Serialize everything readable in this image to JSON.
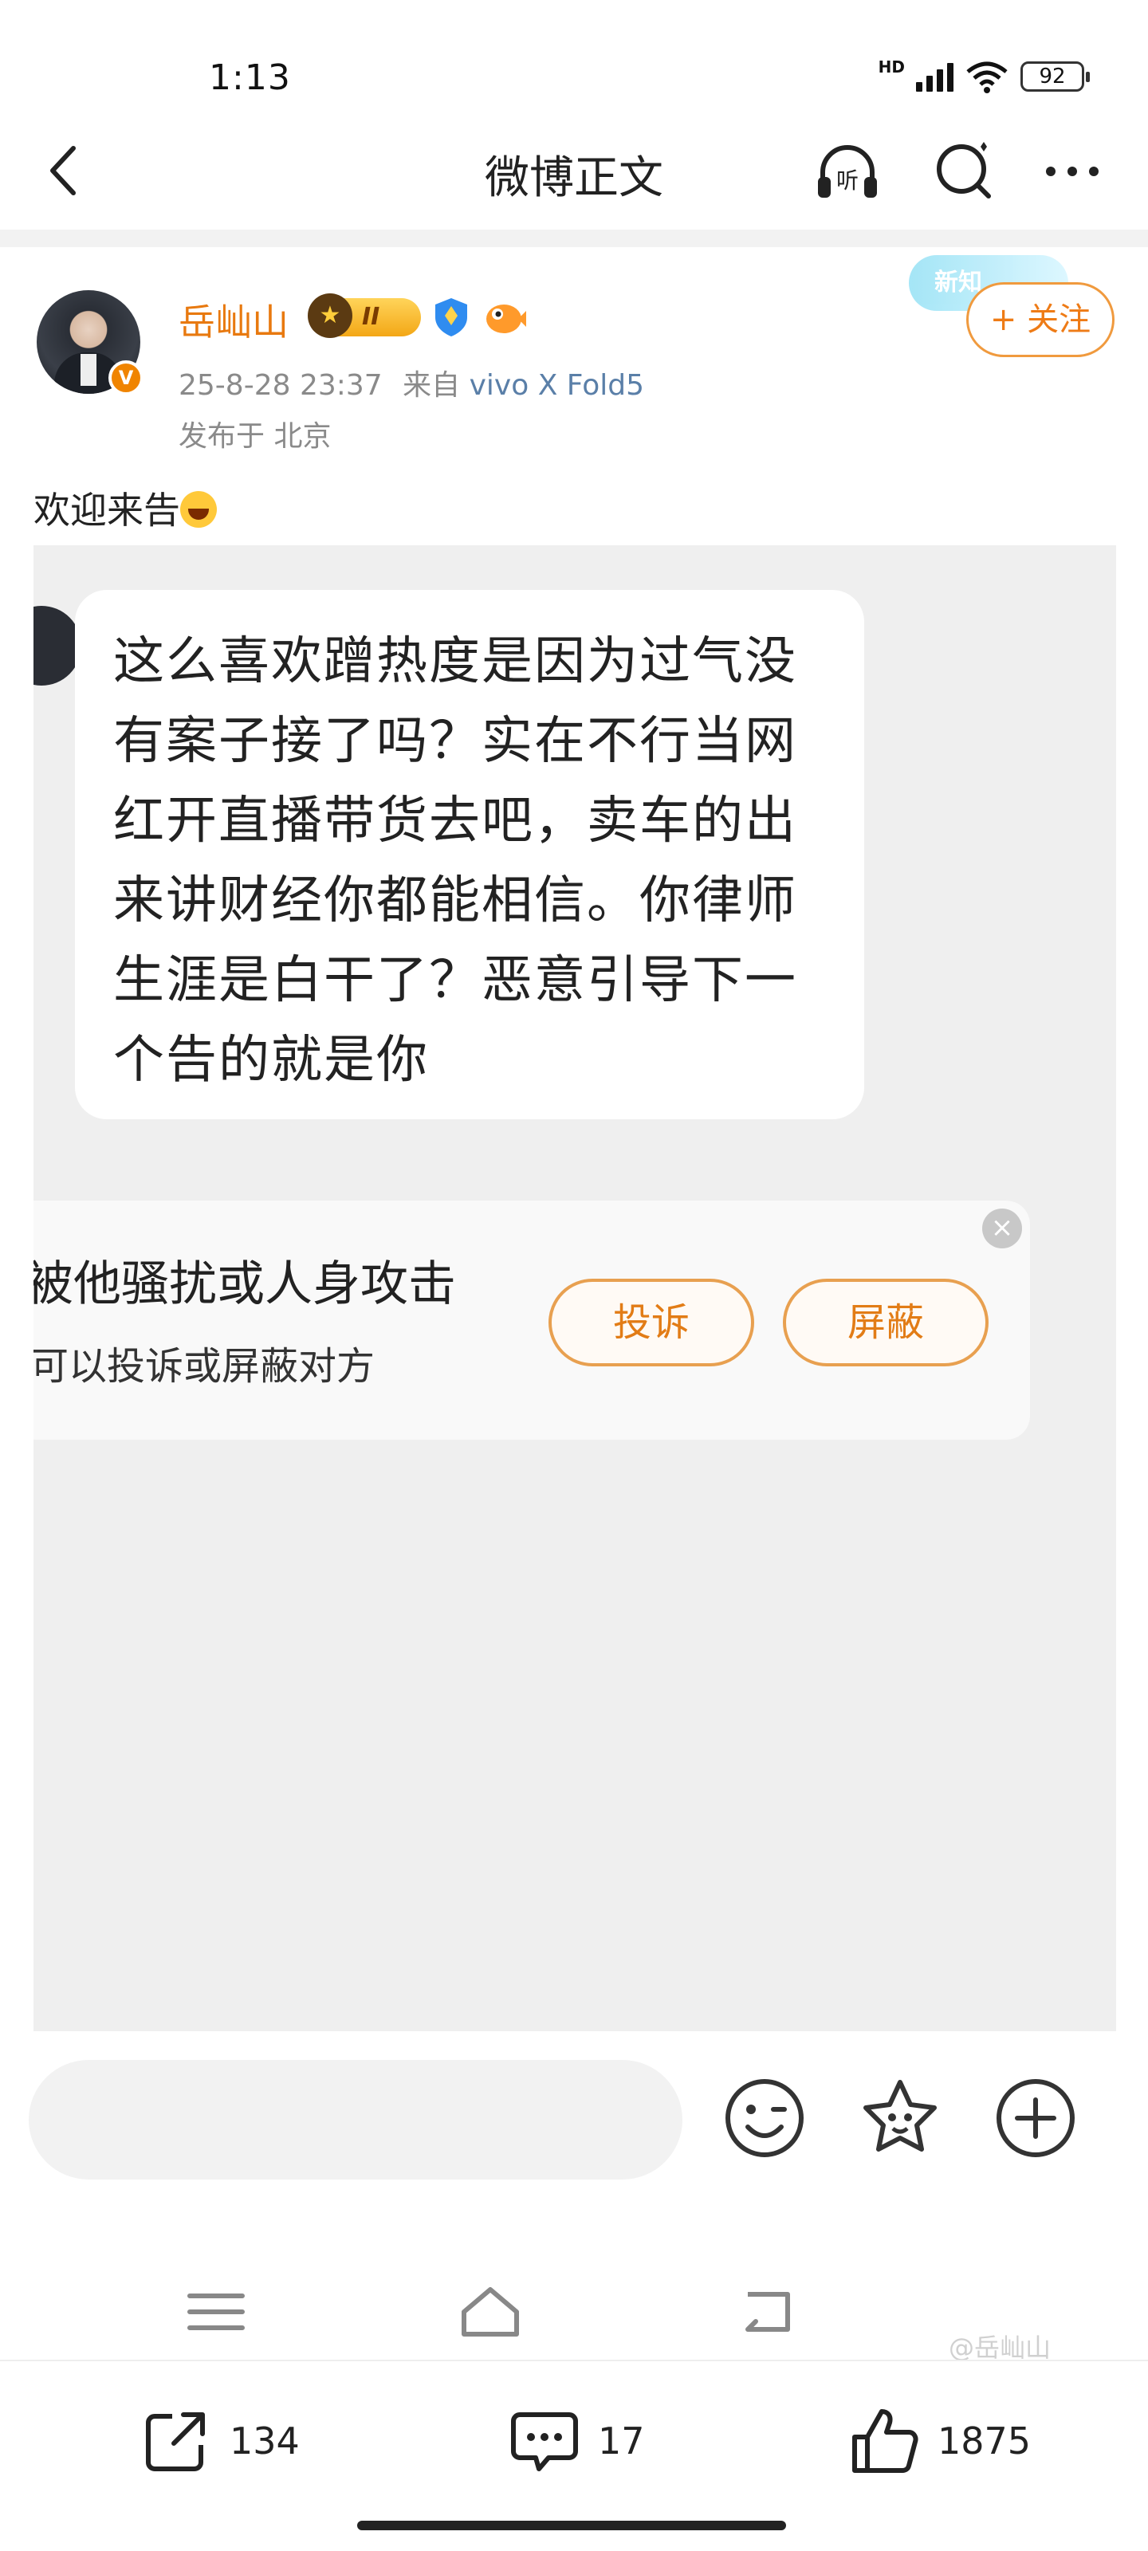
{
  "status_bar": {
    "time": "1:13",
    "network": "HD",
    "battery": "92"
  },
  "nav": {
    "title": "微博正文",
    "listen_label": "听"
  },
  "post": {
    "author": "岳屾山",
    "level_badge": "II",
    "avatar_badge": "V",
    "timestamp": "25-8-28 23:37",
    "source_prefix": "来自",
    "device": "vivo X Fold5",
    "location": "发布于 北京",
    "new_chip": "新知",
    "follow_label": "+ 关注",
    "text": "欢迎来告"
  },
  "screenshot": {
    "message_lines": [
      "这么喜欢蹭热度是因为过气没",
      "有案子接了吗？实在不行当网",
      "红开直播带货去吧，卖车的出",
      "来讲财经你都能相信。你律师",
      "生涯是白干了？恶意引导下一",
      "个告的就是你"
    ],
    "tip_title": "被他骚扰或人身攻击",
    "tip_subtitle": "可以投诉或屏蔽对方",
    "report_label": "投诉",
    "block_label": "屏蔽",
    "close_label": "×"
  },
  "actions": {
    "repost_count": "134",
    "comment_count": "17",
    "like_count": "1875"
  },
  "watermark": "@岳屾山",
  "colors": {
    "accent": "#e8790f",
    "link": "#5a7fa8"
  }
}
